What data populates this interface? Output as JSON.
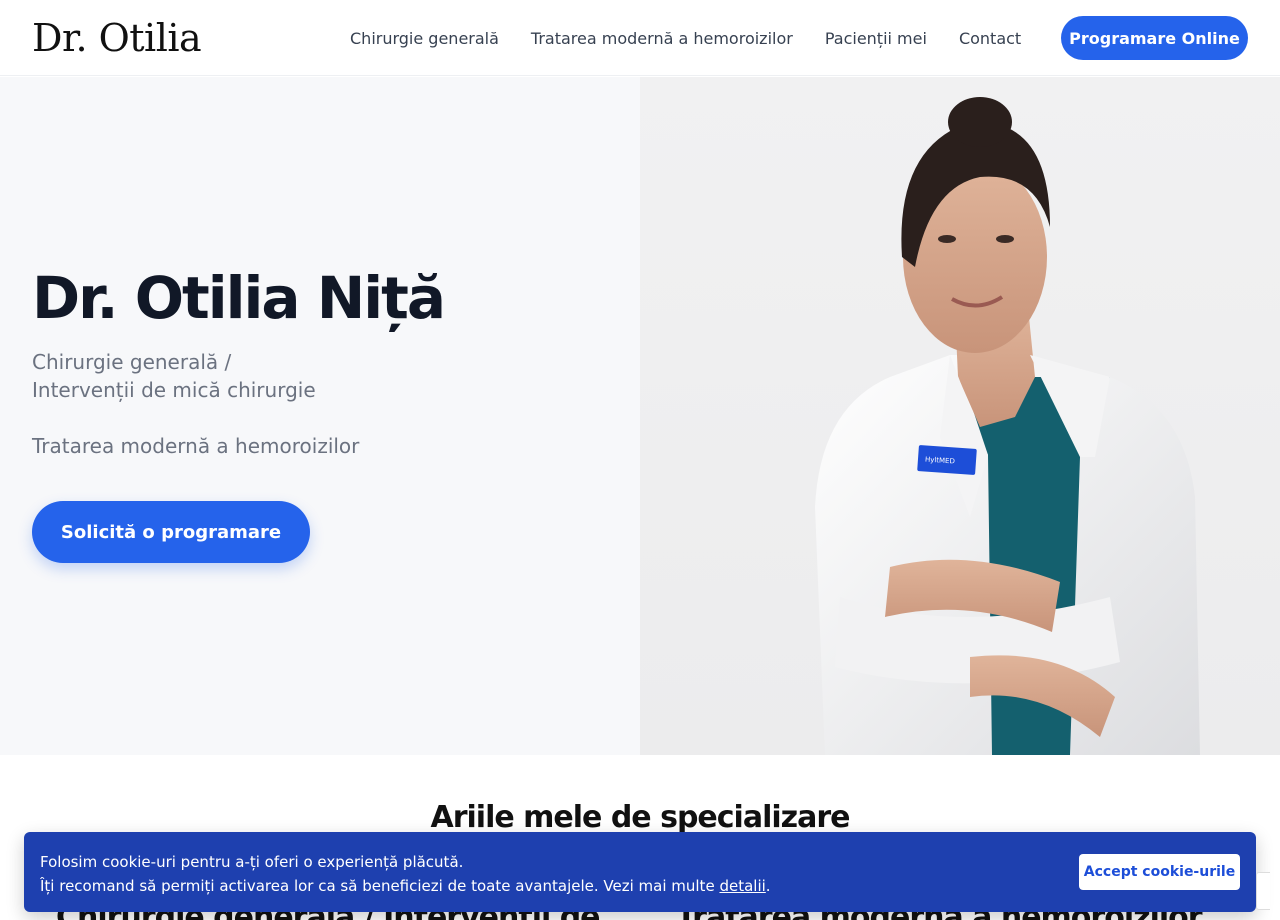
{
  "header": {
    "logo": "Dr. Otilia",
    "nav": [
      "Chirurgie generală",
      "Tratarea modernă a hemoroizilor",
      "Pacienții mei",
      "Contact"
    ],
    "cta": "Programare Online"
  },
  "hero": {
    "title": "Dr. Otilia Niță",
    "subtitle_line1": "Chirurgie generală /",
    "subtitle_line2": "Intervenții de mică chirurgie",
    "subtitle2": "Tratarea modernă a hemoroizilor",
    "button": "Solicită o programare",
    "badge": "HyltMED"
  },
  "specialization": {
    "title": "Ariile mele de specializare",
    "cards": [
      "Chirurgie generală / Intervenții de",
      "Tratarea modernă a hemoroizilor"
    ]
  },
  "cookie": {
    "line1": "Folosim cookie-uri pentru a-ți oferi o experiență plăcută.",
    "line2": "Îți recomand să permiți activarea lor ca să beneficiezi de toate avantajele. Vezi mai multe ",
    "link": "detalii",
    "end": ".",
    "button": "Accept cookie-urile"
  },
  "colors": {
    "accent": "#2563eb",
    "banner": "#1e40af",
    "hero_bg": "#f7f8fa"
  }
}
